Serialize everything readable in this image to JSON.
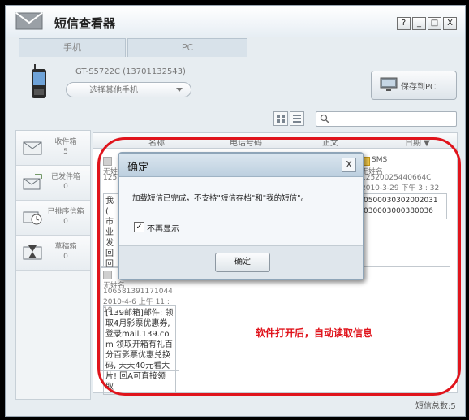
{
  "window": {
    "title": "短信查看器",
    "buttons": [
      "?",
      "_",
      "□",
      "X"
    ]
  },
  "tabs": [
    "手机",
    "PC"
  ],
  "phone": {
    "model": "GT-S5722C (13701132543)",
    "select_placeholder": "选择其他手机"
  },
  "save_button": "保存到PC",
  "sidebar": {
    "folders": [
      {
        "name": "收件箱",
        "count": "5",
        "icon": "inbox-icon"
      },
      {
        "name": "已发件箱",
        "count": "0",
        "icon": "outbox-icon"
      },
      {
        "name": "已排序信箱",
        "count": "0",
        "icon": "scheduled-icon"
      },
      {
        "name": "草稿箱",
        "count": "0",
        "icon": "drafts-icon"
      }
    ]
  },
  "list": {
    "columns": [
      "名称",
      "电话号码",
      "正文",
      "日期 ▼"
    ]
  },
  "cards": [
    {
      "type": "SMS",
      "name": "无姓名",
      "number": "125",
      "date": "",
      "body": "我\n(\n市\n业\n发\n回\n回"
    },
    {
      "type": "SMS",
      "name": "无姓名",
      "number": "12520025440664C",
      "date": "2010-3-29 下午 3 : 32",
      "body": "0500030302002031\n030003000380036"
    },
    {
      "type": "SMS",
      "name": "无姓名",
      "number": "106581391171044",
      "date": "2010-4-6 上午 11 : 19",
      "body": "[139邮箱]邮件: 领取4月影票优惠券, 登录mail.139.com 领取开箱有礼百分百影票优惠兑换码, 天天40元看大片! 回A可直接领取"
    }
  ],
  "annotation": "软件打开后，自动读取信息",
  "status": {
    "sms_total": "短信总数:5"
  },
  "dialog": {
    "title": "确定",
    "message": "加载短信已完成，不支持\"短信存档\"和\"我的短信\"。",
    "checkbox_label": "不再显示",
    "checkbox_checked": "✓",
    "ok_button": "确定",
    "close": "X"
  }
}
